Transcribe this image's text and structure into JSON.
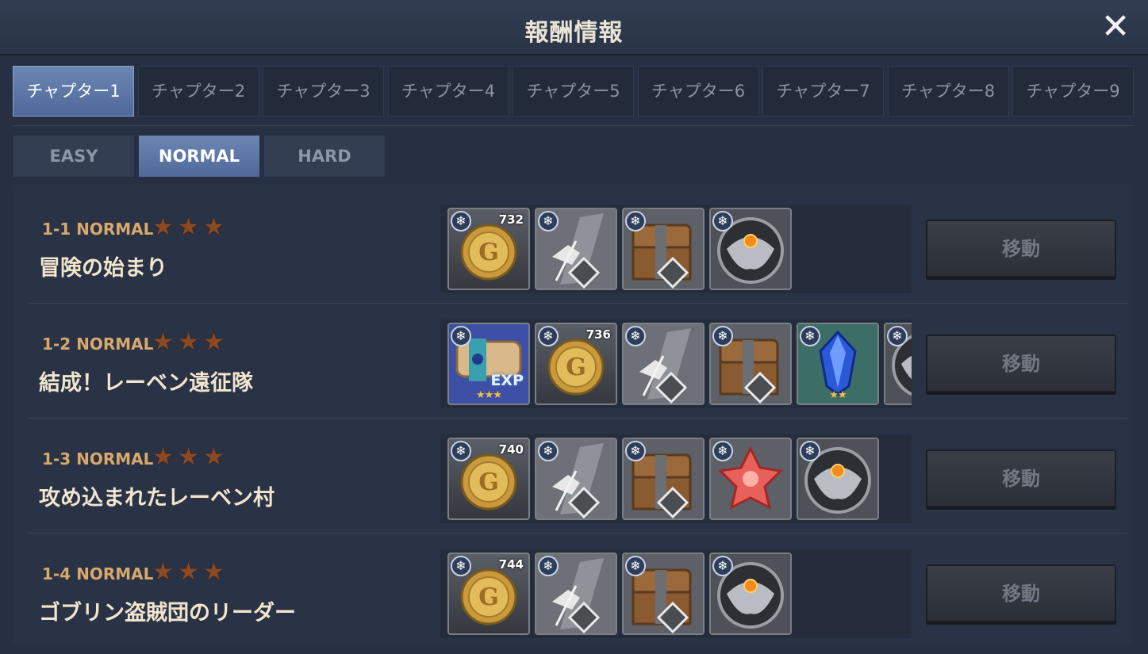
{
  "title": "報酬情報",
  "close_symbol": "✕",
  "chapters": [
    "チャプター1",
    "チャプター2",
    "チャプター3",
    "チャプター4",
    "チャプター5",
    "チャプター6",
    "チャプター7",
    "チャプター8",
    "チャプター9"
  ],
  "active_chapter_index": 0,
  "difficulties": [
    "EASY",
    "NORMAL",
    "HARD"
  ],
  "active_difficulty_index": 1,
  "move_label": "移動",
  "stages": [
    {
      "code": "1-1 NORMAL",
      "stars": 3,
      "name": "冒険の始まり",
      "rewards": [
        {
          "type": "gold-coin-icon",
          "qty": "732"
        },
        {
          "type": "sword-material-icon"
        },
        {
          "type": "treasure-chest-icon"
        },
        {
          "type": "emblem-medal-icon"
        }
      ]
    },
    {
      "code": "1-2 NORMAL",
      "stars": 3,
      "name": "結成！レーベン遠征隊",
      "rewards": [
        {
          "type": "exp-scroll-icon",
          "label": "EXP",
          "grade": "★★★"
        },
        {
          "type": "gold-coin-icon",
          "qty": "736"
        },
        {
          "type": "sword-material-icon"
        },
        {
          "type": "treasure-chest-icon"
        },
        {
          "type": "blue-crystal-icon",
          "grade": "★★"
        },
        {
          "type": "emblem-medal-icon"
        }
      ]
    },
    {
      "code": "1-3 NORMAL",
      "stars": 3,
      "name": "攻め込まれたレーベン村",
      "rewards": [
        {
          "type": "gold-coin-icon",
          "qty": "740"
        },
        {
          "type": "sword-material-icon"
        },
        {
          "type": "treasure-chest-icon"
        },
        {
          "type": "red-gem-icon"
        },
        {
          "type": "emblem-medal-icon"
        }
      ]
    },
    {
      "code": "1-4 NORMAL",
      "stars": 3,
      "name": "ゴブリン盗賊団のリーダー",
      "rewards": [
        {
          "type": "gold-coin-icon",
          "qty": "744"
        },
        {
          "type": "sword-material-icon"
        },
        {
          "type": "treasure-chest-icon"
        },
        {
          "type": "emblem-medal-icon"
        }
      ]
    }
  ],
  "colors": {
    "accent_tab": "#5b76a6",
    "stage_code": "#d9a86c",
    "stage_name": "#f1e6cd",
    "star": "#8a4a25"
  }
}
